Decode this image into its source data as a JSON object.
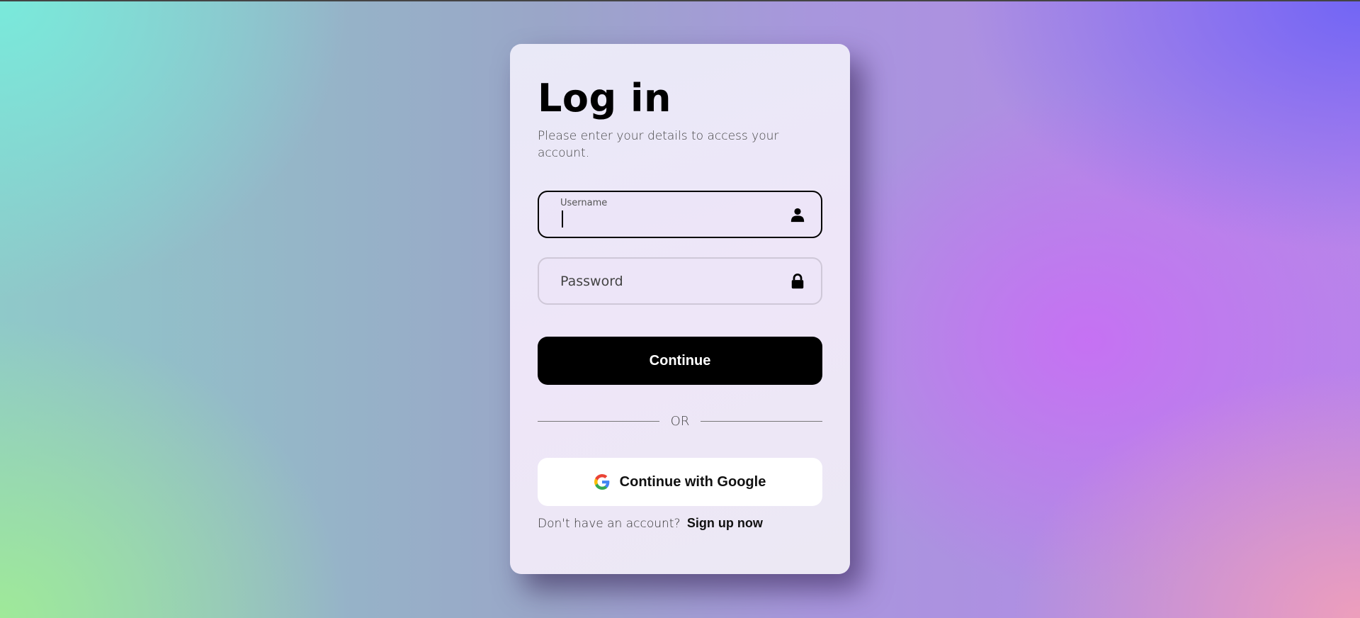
{
  "login": {
    "title": "Log in",
    "subtitle": "Please enter your details to access your account.",
    "username": {
      "label": "Username",
      "value": "",
      "icon": "user-icon"
    },
    "password": {
      "placeholder": "Password",
      "value": "",
      "icon": "lock-icon"
    },
    "continue_label": "Continue",
    "divider_label": "OR",
    "google_label": "Continue with Google",
    "signup_prompt": "Don't have an account?",
    "signup_link": "Sign up now"
  },
  "colors": {
    "primary_button": "#000000",
    "google_blue": "#4285F4",
    "google_red": "#EA4335",
    "google_yellow": "#FBBC05",
    "google_green": "#34A853"
  }
}
